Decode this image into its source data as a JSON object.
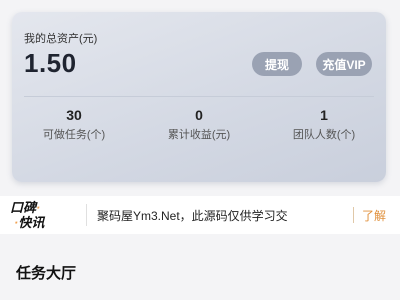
{
  "assets": {
    "label": "我的总资产(元)",
    "value": "1.50",
    "withdraw_label": "提现",
    "vip_label": "充值VIP"
  },
  "stats": [
    {
      "value": "30",
      "label": "可做任务(个)"
    },
    {
      "value": "0",
      "label": "累计收益(元)"
    },
    {
      "value": "1",
      "label": "团队人数(个)"
    }
  ],
  "notice": {
    "logo_line1": "口碑",
    "logo_line2": "快讯",
    "text": "聚码屋Ym3.Net，此源码仅供学习交",
    "link_label": "了解"
  },
  "section": {
    "title": "任务大厅"
  }
}
